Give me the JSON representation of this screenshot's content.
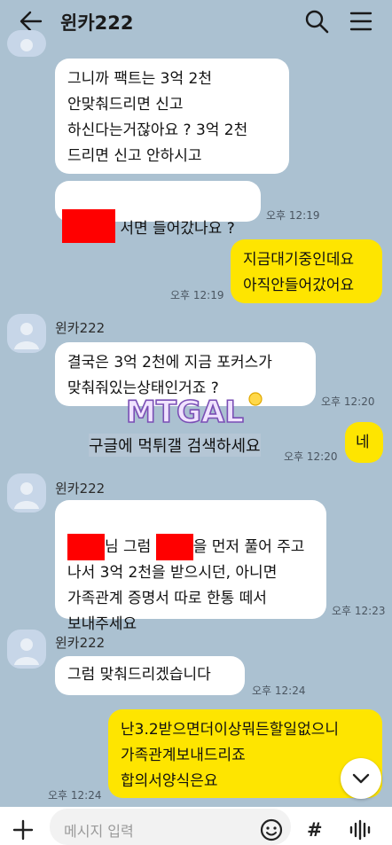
{
  "header": {
    "title": "윈카222",
    "back_icon": "back-arrow-icon",
    "search_icon": "search-icon",
    "menu_icon": "hamburger-menu-icon"
  },
  "messages": {
    "m1": {
      "text": "그니까 팩트는 3억 2천\n안맞춰드리면 신고\n하신다는거잖아요 ? 3억 2천\n드리면 신고 안하시고"
    },
    "m2": {
      "text": " 서면 들어갔나요 ?",
      "time": "오후 12:19"
    },
    "m3": {
      "text": "지금대기중인데요\n아직안들어갔어요",
      "time": "오후 12:19"
    },
    "m4": {
      "sender": "윈카222",
      "text": "결국은 3억 2천에 지금 포커스가\n맞춰줘있는상태인거죠 ?",
      "time": "오후 12:20"
    },
    "m5": {
      "text": "네",
      "time": "오후 12:20"
    },
    "m6": {
      "sender": "윈카222",
      "text_a": "님 그럼 ",
      "text_b": "을 먼저 풀어 주고",
      "text_c": "나서 3억 2천을 받으시던, 아니면\n가족관계 증명서 따로 한통 떼서\n보내주세요",
      "time": "오후 12:23"
    },
    "m7": {
      "sender": "윈카222",
      "text": "그럼 맞춰드리겠습니다",
      "time": "오후 12:24"
    },
    "m8": {
      "text": "난3.2받으면더이상뭐든할일없으니\n가족관계보내드리죠\n합의서양식은요",
      "time": "오후 12:24"
    }
  },
  "watermark": {
    "text": "MTGAL",
    "notice": "구글에 먹튀갤 검색하세요"
  },
  "input": {
    "placeholder": "메시지 입력",
    "hash_label": "#"
  },
  "colors": {
    "background": "#abc1d1",
    "my_bubble": "#fee500",
    "their_bubble": "#ffffff",
    "redaction": "#ff0000"
  }
}
